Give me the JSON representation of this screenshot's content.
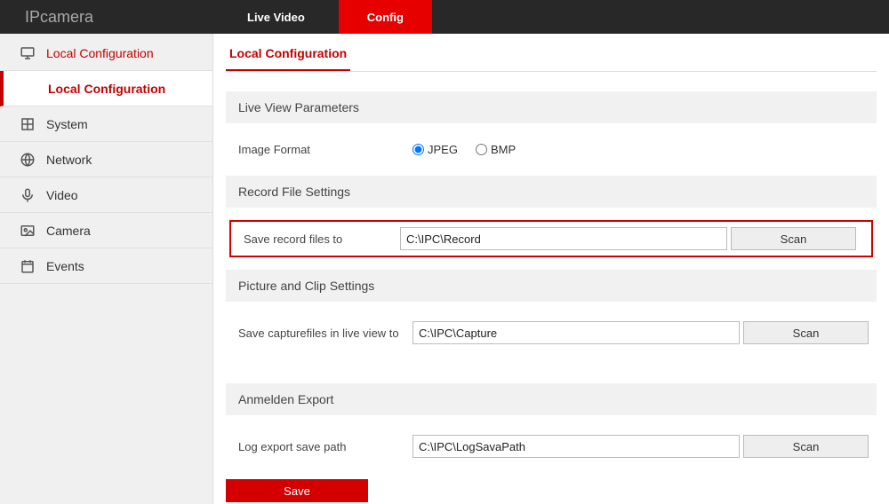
{
  "header": {
    "logo": "IPcamera",
    "tabs": {
      "live": "Live Video",
      "config": "Config"
    }
  },
  "sidebar": {
    "items": [
      {
        "label": "Local Configuration"
      },
      {
        "label": "Local Configuration"
      },
      {
        "label": "System"
      },
      {
        "label": "Network"
      },
      {
        "label": "Video"
      },
      {
        "label": "Camera"
      },
      {
        "label": "Events"
      }
    ]
  },
  "page": {
    "title": "Local Configuration",
    "sections": {
      "liveview": {
        "heading": "Live View Parameters",
        "imgformat_label": "Image Format",
        "opts": {
          "jpeg": "JPEG",
          "bmp": "BMP"
        }
      },
      "record": {
        "heading": "Record File Settings",
        "label": "Save record files to",
        "value": "C:\\IPC\\Record",
        "scan": "Scan"
      },
      "picture": {
        "heading": "Picture and Clip Settings",
        "label": "Save capturefiles in live view to",
        "value": "C:\\IPC\\Capture",
        "scan": "Scan"
      },
      "export": {
        "heading": "Anmelden Export",
        "label": "Log export save path",
        "value": "C:\\IPC\\LogSavaPath",
        "scan": "Scan"
      },
      "save": "Save"
    }
  }
}
